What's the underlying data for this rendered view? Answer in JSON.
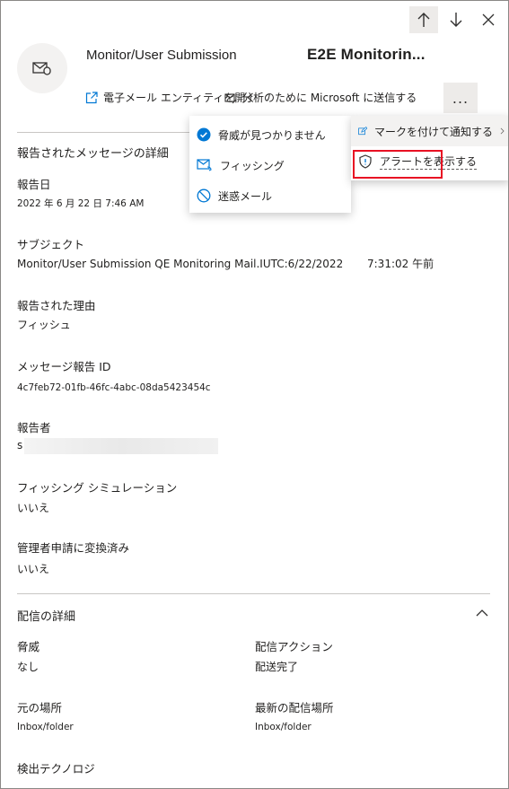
{
  "header": {
    "title": "Monitor/User Submission",
    "subject_title": "E2E Monitorin..."
  },
  "actions": {
    "open_entity": "電子メール エンティティを開く",
    "submit_to_microsoft": "分析のために Microsoft に送信する",
    "more": "..."
  },
  "menu_left": {
    "items": [
      {
        "label": "脅威が見つかりません",
        "icon": "check-circle-icon"
      },
      {
        "label": "フィッシング",
        "icon": "phish-icon"
      },
      {
        "label": "迷惑メール",
        "icon": "block-icon"
      }
    ]
  },
  "menu_right": {
    "items": [
      {
        "label": "マークを付けて通知する",
        "icon": "edit-icon"
      },
      {
        "label": "アラートを表示する",
        "icon": "shield-icon"
      }
    ]
  },
  "details": {
    "section_title": "報告されたメッセージの詳細",
    "reported_date_label": "報告日",
    "reported_date_value": "2022 年 6 月 22 日 7:46 AM",
    "subject_label": "サブジェクト",
    "subject_value": "Monitor/User Submission QE Monitoring Mail.IUTC:6/22/2022",
    "subject_time": "7:31:02 午前",
    "reason_label": "報告された理由",
    "reason_value": "フィッシュ",
    "message_id_label": "メッセージ報告 ID",
    "message_id_value": "4c7feb72-01fb-46fc-4abc-08da5423454c",
    "reporter_label": "報告者",
    "reporter_value": "s",
    "phish_sim_label": "フィッシング シミュレーション",
    "phish_sim_value": "いいえ",
    "admin_conv_label": "管理者申請に変換済み",
    "admin_conv_value": "いいえ"
  },
  "delivery": {
    "section_title": "配信の詳細",
    "threat_label": "脅威",
    "threat_value": "なし",
    "action_label": "配信アクション",
    "action_value": "配送完了",
    "original_location_label": "元の場所",
    "original_location_value": "Inbox/folder",
    "latest_location_label": "最新の配信場所",
    "latest_location_value": "Inbox/folder",
    "detection_label": "検出テクノロジ"
  },
  "colors": {
    "accent": "#0078d4",
    "highlight_border": "#e81123"
  }
}
